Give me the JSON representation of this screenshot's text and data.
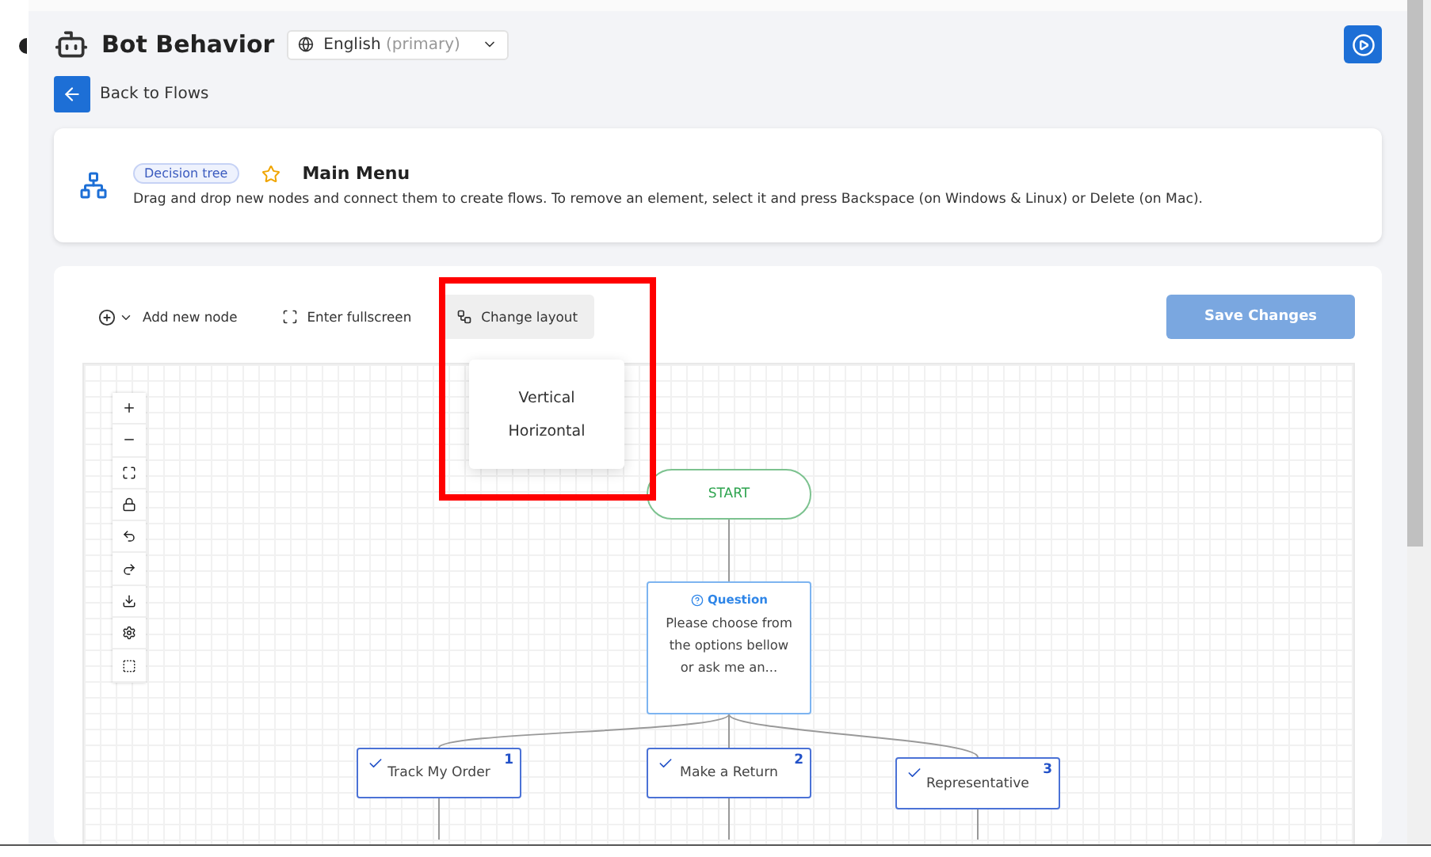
{
  "header": {
    "title": "Bot Behavior",
    "language": {
      "label": "English",
      "note": "(primary)"
    }
  },
  "back_link": {
    "label": "Back to Flows"
  },
  "flow": {
    "badge": "Decision tree",
    "title": "Main Menu",
    "description": "Drag and drop new nodes and connect them to create flows. To remove an element, select it and press Backspace (on Windows & Linux) or Delete (on Mac)."
  },
  "toolbar": [
    {
      "kind": "add",
      "label": "Add new node",
      "selected": false
    },
    {
      "kind": "fullscreen",
      "label": "Enter fullscreen",
      "selected": false
    },
    {
      "kind": "layout",
      "label": "Change layout",
      "selected": true
    }
  ],
  "save_button": {
    "label": "Save Changes",
    "disabled": true
  },
  "layout_menu": {
    "open": true,
    "options": [
      "Vertical",
      "Horizontal"
    ]
  },
  "annotation": {
    "kind": "highlight"
  },
  "canvas": {
    "nodes": [
      {
        "kind": "start",
        "label": "START"
      },
      {
        "kind": "question",
        "heading": "Question",
        "text": "Please choose from the options bellow or ask me an..."
      },
      {
        "kind": "option",
        "label": "Track My Order",
        "number": "1"
      },
      {
        "kind": "option",
        "label": "Make a Return",
        "number": "2"
      },
      {
        "kind": "option",
        "label": "Representative",
        "number": "3"
      }
    ]
  }
}
